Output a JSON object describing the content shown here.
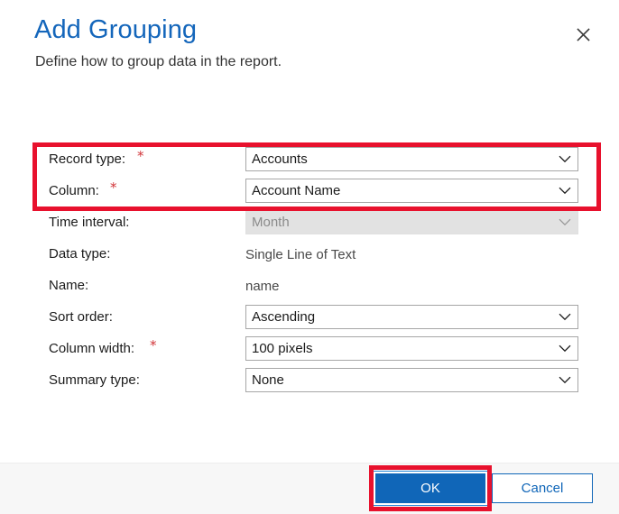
{
  "dialog": {
    "title": "Add Grouping",
    "subtitle": "Define how to group data in the report.",
    "close_icon": "close-icon"
  },
  "form": {
    "rows": [
      {
        "label": "Record type:",
        "required": true,
        "control": "dropdown",
        "value": "Accounts",
        "disabled": false
      },
      {
        "label": "Column:",
        "required": true,
        "control": "dropdown",
        "value": "Account Name",
        "disabled": false
      },
      {
        "label": "Time interval:",
        "required": false,
        "control": "dropdown",
        "value": "Month",
        "disabled": true
      },
      {
        "label": "Data type:",
        "required": false,
        "control": "text",
        "value": "Single Line of Text",
        "disabled": false
      },
      {
        "label": "Name:",
        "required": false,
        "control": "text",
        "value": "name",
        "disabled": false
      },
      {
        "label": "Sort order:",
        "required": false,
        "control": "dropdown",
        "value": "Ascending",
        "disabled": false
      },
      {
        "label": "Column width:",
        "required": true,
        "control": "dropdown",
        "value": "100 pixels",
        "disabled": false
      },
      {
        "label": "Summary type:",
        "required": false,
        "control": "dropdown",
        "value": "None",
        "disabled": false
      }
    ],
    "required_marker": "*",
    "chevron_icon": "chevron-down-icon"
  },
  "footer": {
    "ok_label": "OK",
    "cancel_label": "Cancel"
  },
  "annotations": {
    "fields_highlight": "red-box-required-fields",
    "ok_highlight": "red-box-ok-button"
  },
  "colors": {
    "title_blue": "#1466bb",
    "accent_blue": "#1066b8",
    "required_red": "#d13438",
    "annotation_red": "#e8112d",
    "footer_bg": "#f7f7f7",
    "disabled_bg": "#e2e2e2"
  }
}
